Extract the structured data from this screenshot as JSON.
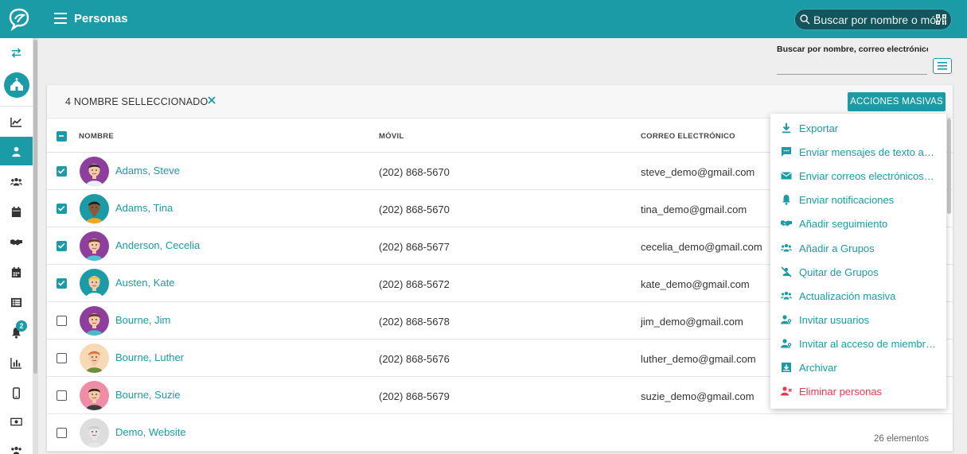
{
  "header": {
    "title": "Personas",
    "search_placeholder": "Buscar por nombre o móvil"
  },
  "sidebar": {
    "notification_count": "2",
    "items": [
      "swap-icon",
      "church-icon",
      "trending-chart-icon",
      "person-icon",
      "groups-icon",
      "calendar-icon",
      "handshake-icon",
      "events-calendar-icon",
      "list-icon",
      "bell-icon",
      "bar-chart-icon",
      "mobile-icon",
      "money-icon",
      "settings-people-icon"
    ]
  },
  "filter": {
    "label": "Buscar por nombre, correo electrónico"
  },
  "selection": {
    "count_label": "4 NOMBRE SELLECCIONADO",
    "mass_actions_label": "ACCIONES MASIVAS"
  },
  "table": {
    "columns": [
      "NOMBRE",
      "MÓVIL",
      "CORREO ELECTRÓNICO"
    ],
    "rows": [
      {
        "name": "Adams, Steve",
        "phone": "(202) 868-5670",
        "email": "steve_demo@gmail.com",
        "checked": true
      },
      {
        "name": "Adams, Tina",
        "phone": "(202) 868-5670",
        "email": "tina_demo@gmail.com",
        "checked": true
      },
      {
        "name": "Anderson, Cecelia",
        "phone": "(202) 868-5677",
        "email": "cecelia_demo@gmail.com",
        "checked": true
      },
      {
        "name": "Austen, Kate",
        "phone": "(202) 868-5672",
        "email": "kate_demo@gmail.com",
        "checked": true
      },
      {
        "name": "Bourne, Jim",
        "phone": "(202) 868-5678",
        "email": "jim_demo@gmail.com",
        "checked": false
      },
      {
        "name": "Bourne, Luther",
        "phone": "(202) 868-5676",
        "email": "luther_demo@gmail.com",
        "checked": false
      },
      {
        "name": "Bourne, Suzie",
        "phone": "(202) 868-5679",
        "email": "suzie_demo@gmail.com",
        "checked": false
      },
      {
        "name": "Demo, Website",
        "phone": "",
        "email": "",
        "checked": false
      }
    ],
    "footer_count": "26 elementos"
  },
  "menu": {
    "items": [
      {
        "label": "Exportar",
        "icon": "download-icon"
      },
      {
        "label": "Enviar mensajes de texto a los seleccionados",
        "icon": "sms-icon"
      },
      {
        "label": "Enviar correos electrónicos a los seleccionados",
        "icon": "email-icon"
      },
      {
        "label": "Enviar notificaciones",
        "icon": "bell-icon"
      },
      {
        "label": "Añadir seguimiento",
        "icon": "handshake-icon"
      },
      {
        "label": "Añadir a Grupos",
        "icon": "groups-icon"
      },
      {
        "label": "Quitar de Grupos",
        "icon": "group-remove-icon"
      },
      {
        "label": "Actualización masiva",
        "icon": "groups-icon"
      },
      {
        "label": "Invitar usuarios",
        "icon": "user-key-icon"
      },
      {
        "label": "Invitar al acceso de miembros",
        "icon": "user-key-icon"
      },
      {
        "label": "Archivar",
        "icon": "archive-icon"
      },
      {
        "label": "Eliminar personas",
        "icon": "user-remove-icon"
      }
    ]
  },
  "colors": {
    "primary": "#1a9ba5",
    "danger": "#e53950"
  }
}
